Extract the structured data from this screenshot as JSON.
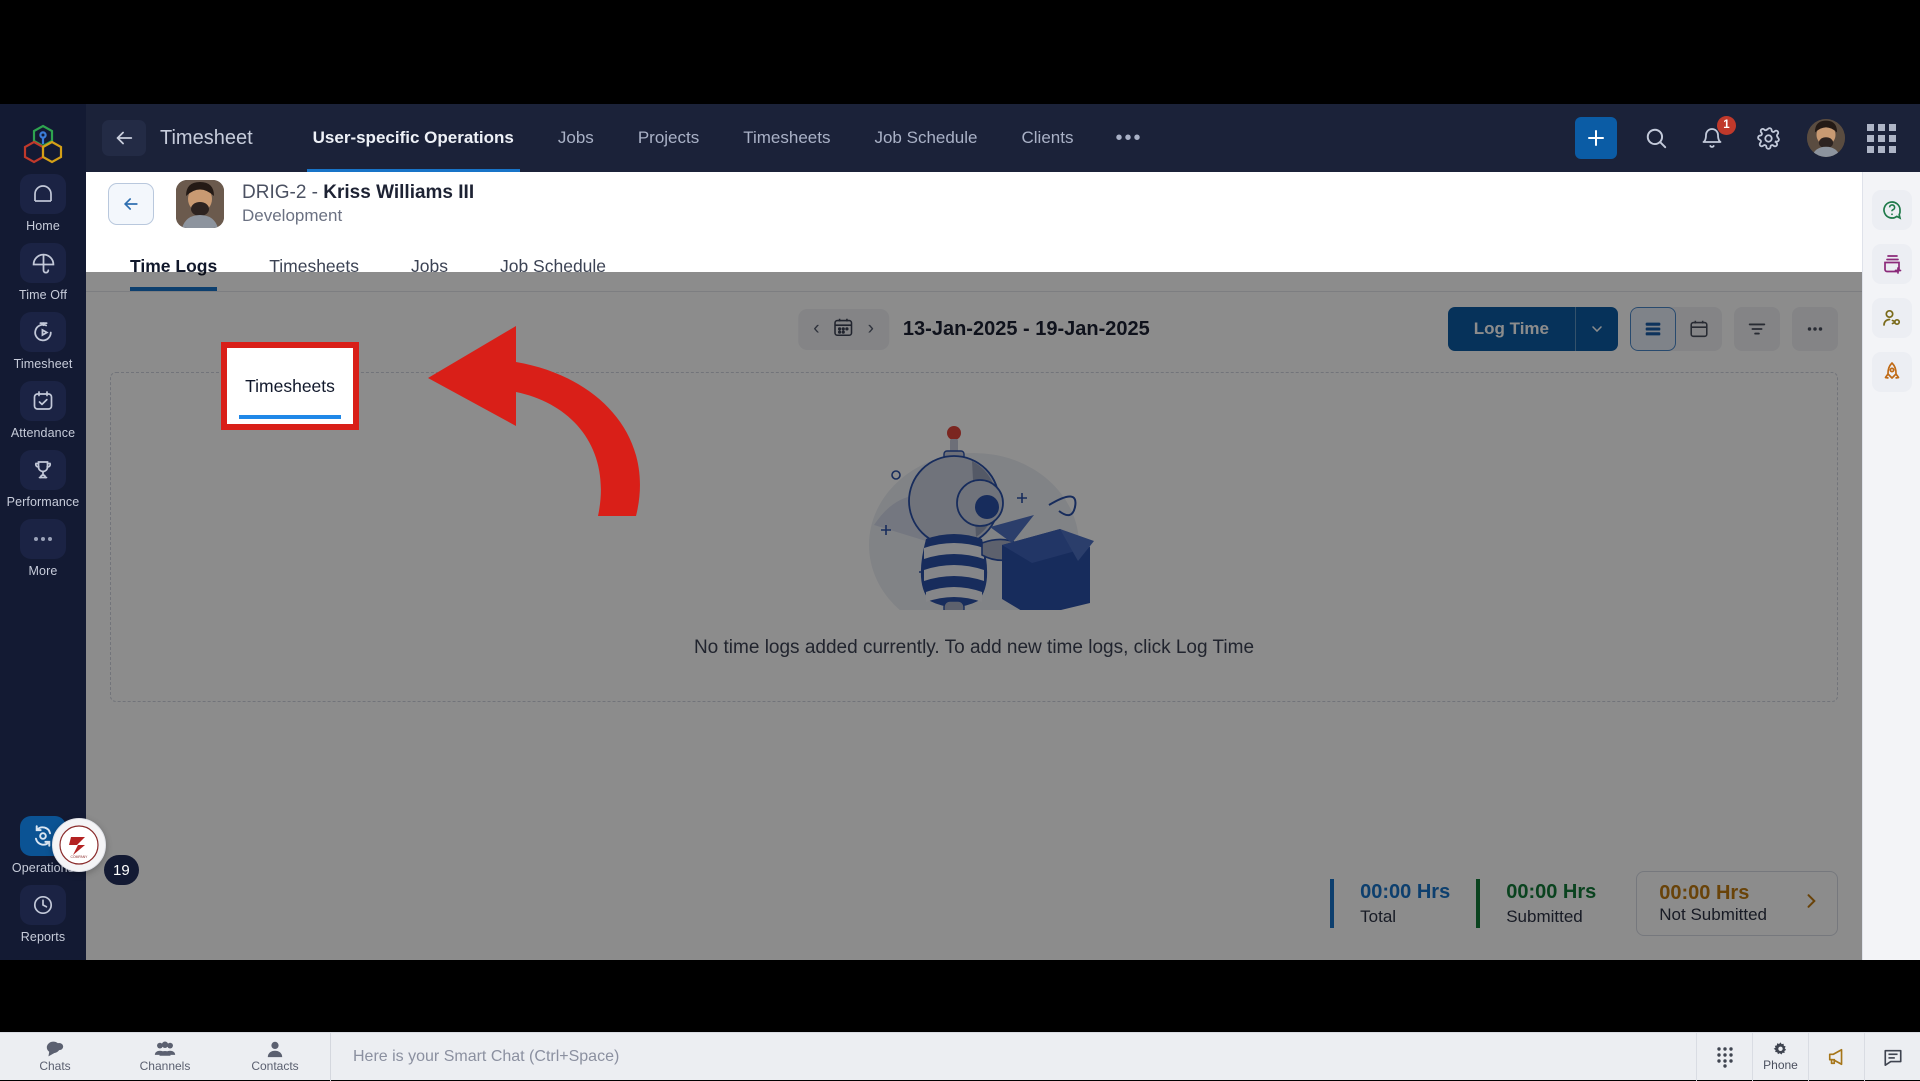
{
  "topnav": {
    "back_icon": "arrow-left-icon",
    "app_title": "Timesheet",
    "tabs": [
      {
        "label": "User-specific Operations",
        "active": true
      },
      {
        "label": "Jobs",
        "active": false
      },
      {
        "label": "Projects",
        "active": false
      },
      {
        "label": "Timesheets",
        "active": false
      },
      {
        "label": "Job Schedule",
        "active": false
      },
      {
        "label": "Clients",
        "active": false
      }
    ],
    "more_label": "•••",
    "actions": {
      "add_label": "+",
      "search_icon": "search-icon",
      "notifications_icon": "bell-icon",
      "notifications_count": "1",
      "settings_icon": "gear-icon",
      "avatar": "user-avatar",
      "apps_icon": "grid-apps-icon"
    }
  },
  "sidebar": {
    "brand": "zoho-people-logo",
    "items": [
      {
        "label": "Home",
        "icon": "home-icon",
        "active": false
      },
      {
        "label": "Time Off",
        "icon": "umbrella-icon",
        "active": false
      },
      {
        "label": "Timesheet",
        "icon": "stopwatch-icon",
        "active": false
      },
      {
        "label": "Attendance",
        "icon": "calendar-check-icon",
        "active": false
      },
      {
        "label": "Performance",
        "icon": "trophy-icon",
        "active": false
      },
      {
        "label": "More",
        "icon": "ellipsis-icon",
        "active": false
      }
    ],
    "bottom_items": [
      {
        "label": "Operations",
        "icon": "operations-refresh-icon",
        "active": true
      },
      {
        "label": "Reports",
        "icon": "clock-report-icon",
        "active": false
      }
    ]
  },
  "right_rail": {
    "items": [
      {
        "icon": "help-circle-icon",
        "name": "help"
      },
      {
        "icon": "printer-add-icon",
        "name": "add-record"
      },
      {
        "icon": "user-share-icon",
        "name": "share-user"
      },
      {
        "icon": "rocket-icon",
        "name": "whats-new"
      }
    ]
  },
  "user_header": {
    "back_icon": "arrow-left-icon",
    "avatar": "employee-avatar",
    "employee_id": "DRIG-2 - ",
    "employee_name": "Kriss Williams III",
    "department": "Development"
  },
  "subtabs": [
    {
      "label": "Time Logs",
      "active": true
    },
    {
      "label": "Timesheets",
      "active": false
    },
    {
      "label": "Jobs",
      "active": false
    },
    {
      "label": "Job Schedule",
      "active": false
    }
  ],
  "toolbar": {
    "prev_icon": "chevron-left-icon",
    "calendar_icon": "calendar-icon",
    "next_icon": "chevron-right-icon",
    "date_range": "13-Jan-2025 - 19-Jan-2025",
    "log_time_label": "Log Time",
    "log_time_caret": "chevron-down-icon",
    "view_list_icon": "list-view-icon",
    "view_calendar_icon": "calendar-view-icon",
    "filter_icon": "filter-icon",
    "more_icon": "ellipsis-icon"
  },
  "empty_state": {
    "illustration": "robot-with-box-illustration",
    "message": "No time logs added currently. To add new time logs, click Log Time"
  },
  "summary": [
    {
      "value": "00:00 Hrs",
      "label": "Total",
      "color": "#1874c8"
    },
    {
      "value": "00:00 Hrs",
      "label": "Submitted",
      "color": "#137a3a"
    }
  ],
  "summary_card": {
    "value": "00:00 Hrs",
    "label": "Not Submitted",
    "color": "#c07a11",
    "chevron_icon": "chevron-right-icon"
  },
  "floating": {
    "badge_icon": "company-logo-badge",
    "count": "19"
  },
  "chatbar": {
    "tabs": [
      {
        "label": "Chats",
        "icon": "chat-bubble-icon"
      },
      {
        "label": "Channels",
        "icon": "people-group-icon"
      },
      {
        "label": "Contacts",
        "icon": "contact-person-icon"
      }
    ],
    "input_placeholder": "Here is your Smart Chat (Ctrl+Space)",
    "right_buttons": [
      {
        "label": "",
        "icon": "dialpad-icon"
      },
      {
        "label": "Phone",
        "icon": "phone-settings-icon"
      },
      {
        "label": "",
        "icon": "megaphone-icon"
      },
      {
        "label": "",
        "icon": "message-icon"
      }
    ]
  },
  "annotation": {
    "highlight_label": "Timesheets",
    "box_color": "#d91f18",
    "arrow_color": "#d91f18"
  }
}
